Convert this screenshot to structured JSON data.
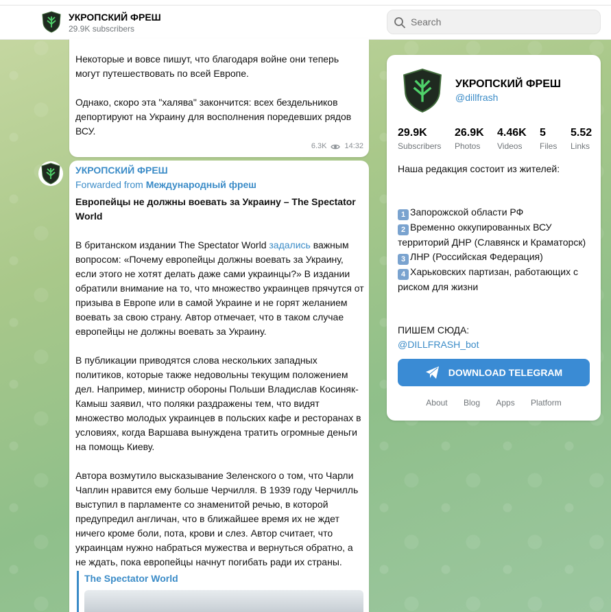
{
  "header": {
    "channel_title": "УКРОПСКИЙ ФРЕШ",
    "subscribers": "29.9K subscribers",
    "search_placeholder": "Search"
  },
  "post1": {
    "lines": [
      "Некоторые и вовсе пишут, что благодаря войне они теперь",
      "могут путешествовать по всей Европе.",
      "Однако, скоро эта \"халява\" закончится: всех бездельников",
      "депортируют на Украину для восполнения поредевших рядов",
      "ВСУ."
    ],
    "views": "6.3K",
    "time": "14:32"
  },
  "post2": {
    "author": "УКРОПСКИЙ ФРЕШ",
    "forwarded_label": "Forwarded from",
    "forwarded_source": "Международный фреш",
    "headline": "Европейцы не должны воевать за Украину – The Spectator World",
    "para1_before": "В британском издании The Spectator World ",
    "para1_link": "задались",
    "para1_after": " важным вопросом: «Почему европейцы должны воевать за Украину, если этого не хотят делать даже сами украинцы?» В издании обратили внимание на то, что множество украинцев прячутся от призыва в Европе или в самой Украине и не горят желанием воевать за свою страну. Автор отмечает, что в таком случае европейцы не должны воевать за Украину.",
    "para2": "В публикации приводятся слова нескольких западных политиков, которые также недовольны текущим положением дел. Например, министр обороны Польши Владислав Косиняк-Камыш заявил, что поляки раздражены тем, что видят множество молодых украинцев в польских кафе и ресторанах в условиях, когда Варшава вынуждена тратить огромные деньги на помощь Киеву.",
    "para3": "Автора возмутило высказывание Зеленского о том, что Чарли Чаплин нравится ему больше Черчилля. В 1939 году Черчилль выступил в парламенте со знаменитой речью, в которой предупредил англичан, что в ближайшее время их не ждет ничего кроме боли, пота, крови и слез. Автор считает, что украинцам нужно набраться мужества и вернуться обратно, а не ждать, пока европейцы начнут погибать ради их страны.",
    "preview_site": "The Spectator World"
  },
  "card": {
    "title": "УКРОПСКИЙ ФРЕШ",
    "handle": "@dillfrash",
    "stats": [
      {
        "num": "29.9K",
        "label": "Subscribers"
      },
      {
        "num": "26.9K",
        "label": "Photos"
      },
      {
        "num": "4.46K",
        "label": "Videos"
      },
      {
        "num": "5",
        "label": "Files"
      },
      {
        "num": "5.52",
        "label": "Links"
      }
    ],
    "desc_intro": "Наша редакция состоит из жителей:",
    "items": [
      {
        "n": "1",
        "text": "Запорожской области РФ"
      },
      {
        "n": "2",
        "text": "Временно оккупированных ВСУ"
      },
      {
        "n": "3",
        "text": "ЛНР (Российская Федерация)"
      },
      {
        "n": "4",
        "text": "Харьковских партизан, работающих с"
      }
    ],
    "item2_cont": "территорий ДНР (Славянск и Краматорск)",
    "item4_cont": "риском для жизни",
    "write_here": "ПИШЕМ СЮДА:",
    "bot": "@DILLFRASH_bot",
    "download_label": "DOWNLOAD TELEGRAM",
    "footer": [
      "About",
      "Blog",
      "Apps",
      "Platform"
    ]
  },
  "colors": {
    "accent": "#3a8bc7",
    "button": "#3a8bd4"
  }
}
